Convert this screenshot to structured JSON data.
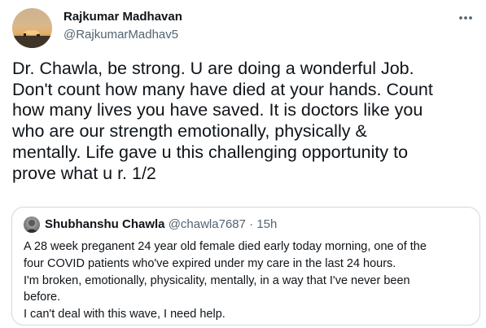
{
  "author": {
    "name": "Rajkumar Madhavan",
    "handle": "@RajkumarMadhav5"
  },
  "tweet": {
    "text": "Dr. Chawla, be strong. U are doing a wonderful Job.\nDon't count how many have died at your hands. Count\nhow many lives you have saved. It is doctors like you\nwho  are our strength emotionally, physically &\nmentally. Life gave u this challenging opportunity to\nprove what u r. 1/2"
  },
  "icons": {
    "more": "more-horizontal-icon"
  },
  "quote": {
    "name": "Shubhanshu Chawla",
    "handle": "@chawla7687",
    "separator": "·",
    "time": "15h",
    "lines": [
      "A 28 week preganent 24 year old female died early today morning, one of the",
      "four COVID patients who've expired under my care in the last 24 hours.",
      "I'm broken, emotionally, physicality, mentally, in a way that I've never been",
      "before.",
      "I can't deal with this wave, I need help."
    ]
  }
}
